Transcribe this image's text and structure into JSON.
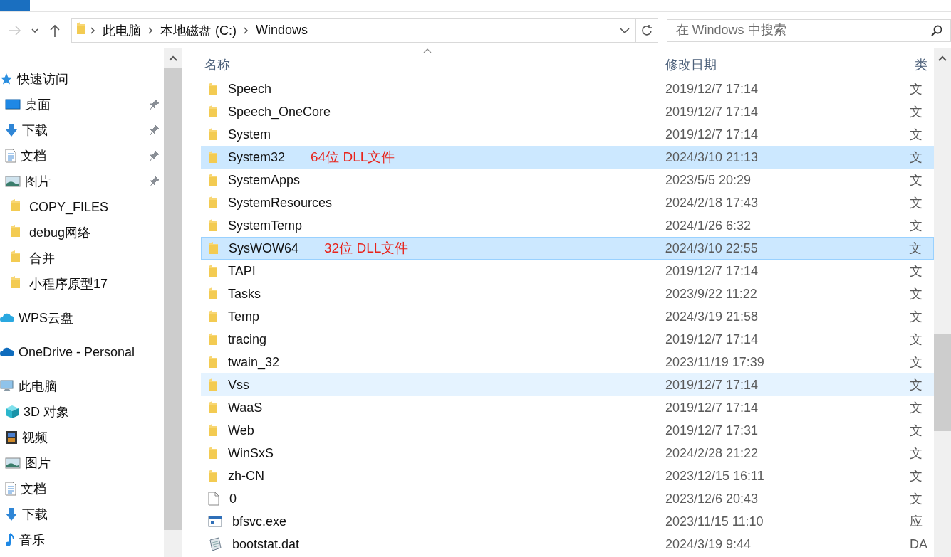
{
  "ribbon": {
    "tabs": [
      {
        "selected": true
      }
    ]
  },
  "address": {
    "segments": [
      "此电脑",
      "本地磁盘 (C:)",
      "Windows"
    ]
  },
  "search": {
    "placeholder": "在 Windows 中搜索"
  },
  "sidebar": {
    "sections": [
      {
        "label": "快速访问",
        "kind": "star",
        "children": [
          {
            "label": "桌面",
            "kind": "desktop",
            "pinned": true
          },
          {
            "label": "下载",
            "kind": "download",
            "pinned": true
          },
          {
            "label": "文档",
            "kind": "document",
            "pinned": true
          },
          {
            "label": "图片",
            "kind": "pictures",
            "pinned": true
          },
          {
            "label": "COPY_FILES",
            "kind": "folder",
            "pinned": false
          },
          {
            "label": "debug网络",
            "kind": "folder",
            "pinned": false
          },
          {
            "label": "合并",
            "kind": "folder",
            "pinned": false
          },
          {
            "label": "小程序原型17",
            "kind": "folder",
            "pinned": false
          }
        ]
      },
      {
        "label": "WPS云盘",
        "kind": "wps"
      },
      {
        "label": "OneDrive - Personal",
        "kind": "onedrive"
      },
      {
        "label": "此电脑",
        "kind": "computer",
        "children": [
          {
            "label": "3D 对象",
            "kind": "cube",
            "pinned": false
          },
          {
            "label": "视频",
            "kind": "video",
            "pinned": false
          },
          {
            "label": "图片",
            "kind": "pictures",
            "pinned": false
          },
          {
            "label": "文档",
            "kind": "document",
            "pinned": false
          },
          {
            "label": "下载",
            "kind": "download",
            "pinned": false
          },
          {
            "label": "音乐",
            "kind": "music",
            "pinned": false
          }
        ]
      }
    ]
  },
  "table": {
    "columns": [
      "名称",
      "修改日期",
      "类"
    ],
    "rows": [
      {
        "name": "Speech",
        "date": "2019/12/7 17:14",
        "type": "文",
        "kind": "folder",
        "selected": false,
        "focused": false,
        "hovered": false
      },
      {
        "name": "Speech_OneCore",
        "date": "2019/12/7 17:14",
        "type": "文",
        "kind": "folder",
        "selected": false,
        "focused": false,
        "hovered": false
      },
      {
        "name": "System",
        "date": "2019/12/7 17:14",
        "type": "文",
        "kind": "folder",
        "selected": false,
        "focused": false,
        "hovered": false
      },
      {
        "name": "System32",
        "date": "2024/3/10 21:13",
        "type": "文",
        "kind": "folder",
        "selected": true,
        "focused": false,
        "hovered": false,
        "annotation": "64位 DLL文件"
      },
      {
        "name": "SystemApps",
        "date": "2023/5/5 20:29",
        "type": "文",
        "kind": "folder",
        "selected": false,
        "focused": false,
        "hovered": false
      },
      {
        "name": "SystemResources",
        "date": "2024/2/18 17:43",
        "type": "文",
        "kind": "folder",
        "selected": false,
        "focused": false,
        "hovered": false
      },
      {
        "name": "SystemTemp",
        "date": "2024/1/26 6:32",
        "type": "文",
        "kind": "folder",
        "selected": false,
        "focused": false,
        "hovered": false
      },
      {
        "name": "SysWOW64",
        "date": "2024/3/10 22:55",
        "type": "文",
        "kind": "folder",
        "selected": true,
        "focused": true,
        "hovered": false,
        "annotation": "32位 DLL文件"
      },
      {
        "name": "TAPI",
        "date": "2019/12/7 17:14",
        "type": "文",
        "kind": "folder",
        "selected": false,
        "focused": false,
        "hovered": false
      },
      {
        "name": "Tasks",
        "date": "2023/9/22 11:22",
        "type": "文",
        "kind": "folder",
        "selected": false,
        "focused": false,
        "hovered": false
      },
      {
        "name": "Temp",
        "date": "2024/3/19 21:58",
        "type": "文",
        "kind": "folder",
        "selected": false,
        "focused": false,
        "hovered": false
      },
      {
        "name": "tracing",
        "date": "2019/12/7 17:14",
        "type": "文",
        "kind": "folder",
        "selected": false,
        "focused": false,
        "hovered": false
      },
      {
        "name": "twain_32",
        "date": "2023/11/19 17:39",
        "type": "文",
        "kind": "folder",
        "selected": false,
        "focused": false,
        "hovered": false
      },
      {
        "name": "Vss",
        "date": "2019/12/7 17:14",
        "type": "文",
        "kind": "folder",
        "selected": false,
        "focused": false,
        "hovered": true
      },
      {
        "name": "WaaS",
        "date": "2019/12/7 17:14",
        "type": "文",
        "kind": "folder",
        "selected": false,
        "focused": false,
        "hovered": false
      },
      {
        "name": "Web",
        "date": "2019/12/7 17:31",
        "type": "文",
        "kind": "folder",
        "selected": false,
        "focused": false,
        "hovered": false
      },
      {
        "name": "WinSxS",
        "date": "2024/2/28 21:22",
        "type": "文",
        "kind": "folder",
        "selected": false,
        "focused": false,
        "hovered": false
      },
      {
        "name": "zh-CN",
        "date": "2023/12/15 16:11",
        "type": "文",
        "kind": "folder",
        "selected": false,
        "focused": false,
        "hovered": false
      },
      {
        "name": "0",
        "date": "2023/12/6 20:43",
        "type": "文",
        "kind": "file",
        "selected": false,
        "focused": false,
        "hovered": false
      },
      {
        "name": "bfsvc.exe",
        "date": "2023/11/15 11:10",
        "type": "应",
        "kind": "exe",
        "selected": false,
        "focused": false,
        "hovered": false
      },
      {
        "name": "bootstat.dat",
        "date": "2024/3/19 9:44",
        "type": "DA",
        "kind": "dat",
        "selected": false,
        "focused": false,
        "hovered": false
      }
    ]
  }
}
